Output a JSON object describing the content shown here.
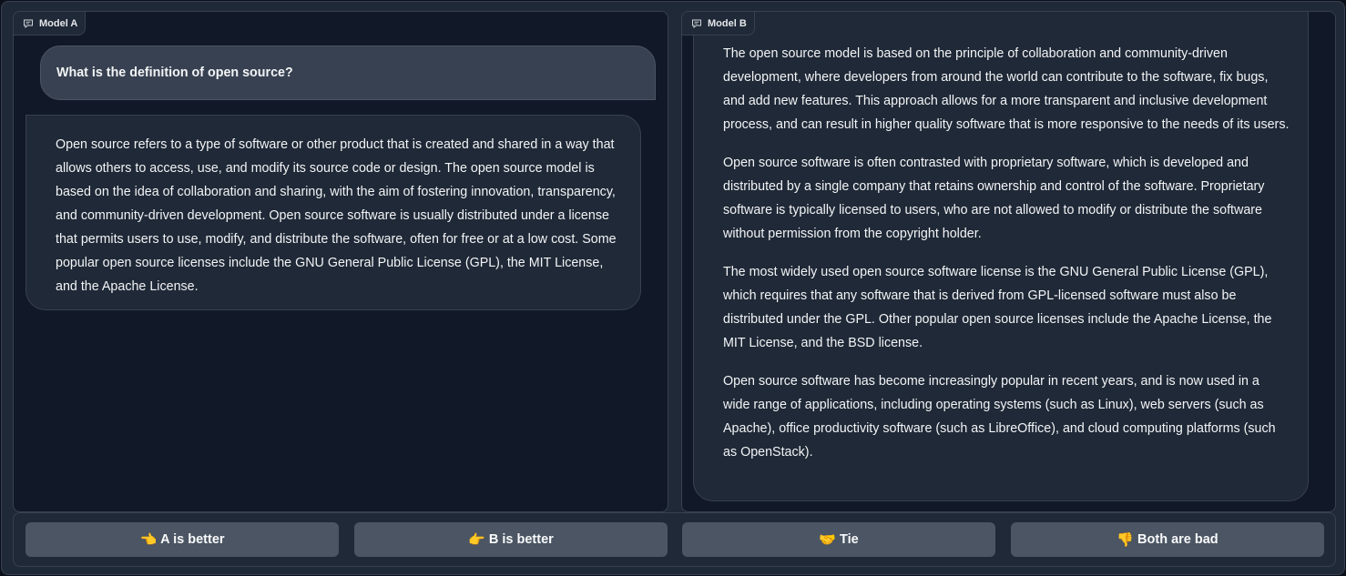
{
  "model_a": {
    "label": "Model A",
    "user_message": "What is the definition of open source?",
    "response": "Open source refers to a type of software or other product that is created and shared in a way that allows others to access, use, and modify its source code or design. The open source model is based on the idea of collaboration and sharing, with the aim of fostering innovation, transparency, and community-driven development. Open source software is usually distributed under a license that permits users to use, modify, and distribute the software, often for free or at a low cost. Some popular open source licenses include the GNU General Public License (GPL), the MIT License, and the Apache License."
  },
  "model_b": {
    "label": "Model B",
    "paragraphs": [
      "The open source model is based on the principle of collaboration and community-driven development, where developers from around the world can contribute to the software, fix bugs, and add new features. This approach allows for a more transparent and inclusive development process, and can result in higher quality software that is more responsive to the needs of its users.",
      "Open source software is often contrasted with proprietary software, which is developed and distributed by a single company that retains ownership and control of the software. Proprietary software is typically licensed to users, who are not allowed to modify or distribute the software without permission from the copyright holder.",
      "The most widely used open source software license is the GNU General Public License (GPL), which requires that any software that is derived from GPL-licensed software must also be distributed under the GPL. Other popular open source licenses include the Apache License, the MIT License, and the BSD license.",
      "Open source software has become increasingly popular in recent years, and is now used in a wide range of applications, including operating systems (such as Linux), web servers (such as Apache), office productivity software (such as LibreOffice), and cloud computing platforms (such as OpenStack)."
    ]
  },
  "vote_buttons": [
    {
      "emoji": "👈",
      "label": "A is better",
      "icon": "pointing-left-icon"
    },
    {
      "emoji": "👉",
      "label": "B is better",
      "icon": "pointing-right-icon"
    },
    {
      "emoji": "🤝",
      "label": "Tie",
      "icon": "handshake-icon"
    },
    {
      "emoji": "👎",
      "label": "Both are bad",
      "icon": "thumbs-down-icon"
    }
  ],
  "colors": {
    "background": "#1f2937",
    "panel": "#111827",
    "border": "#374151",
    "user_bubble": "#374151",
    "bot_bubble": "#1f2937",
    "button": "#4b5563"
  }
}
